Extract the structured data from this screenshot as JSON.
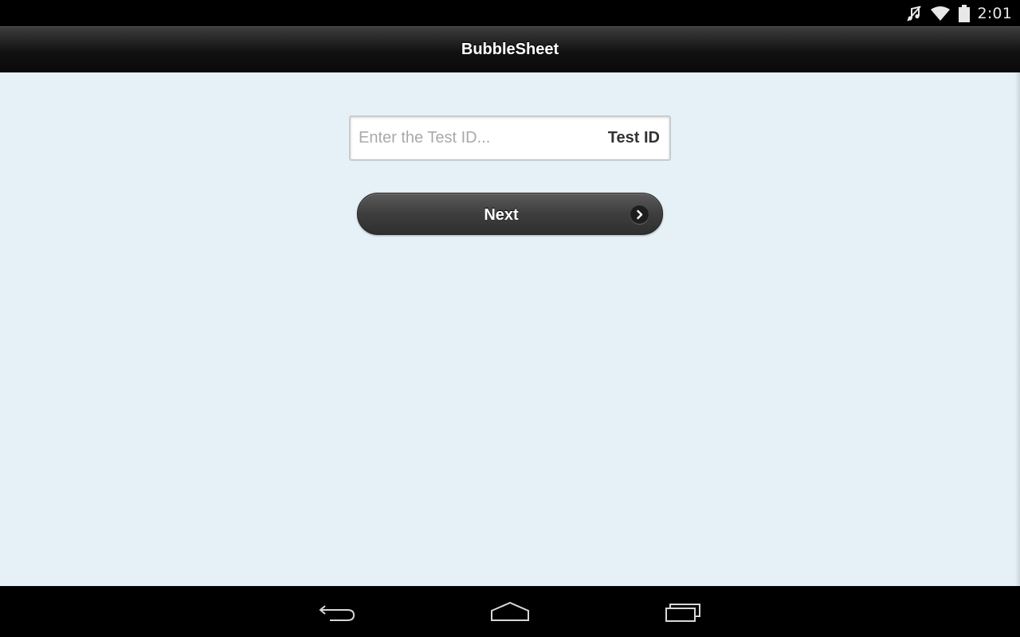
{
  "status_bar": {
    "time": "2:01",
    "icons": [
      "mute-icon",
      "wifi-icon",
      "battery-icon"
    ]
  },
  "header": {
    "title": "BubbleSheet"
  },
  "form": {
    "test_id": {
      "placeholder": "Enter the Test ID...",
      "value": "",
      "label": "Test ID"
    },
    "next_button": {
      "label": "Next",
      "icon": "chevron-right-circle-icon"
    }
  },
  "nav_bar": {
    "icons": [
      "back-icon",
      "home-icon",
      "recent-apps-icon"
    ]
  },
  "colors": {
    "background": "#e5f0f7",
    "header": "#111111",
    "button": "#3e3e3e",
    "system_bars": "#000000"
  }
}
